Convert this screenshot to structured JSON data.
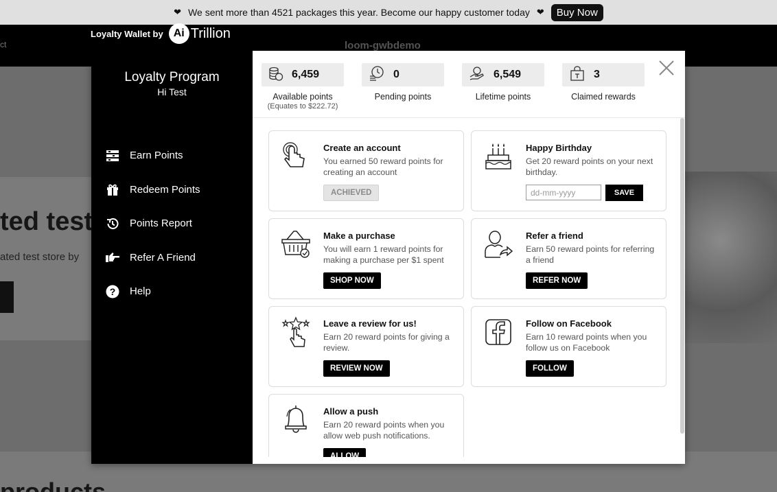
{
  "announcement": {
    "heart_left": "❤",
    "text": "We sent more than 4521 packages this year. Become our happy customer today",
    "heart_right": "❤",
    "buy_label": "Buy Now"
  },
  "store": {
    "nav_fragment": "ct",
    "name": "loom-gwbdemo",
    "hero_title": "ted test",
    "hero_sub": "ated test store by",
    "products_title": "products"
  },
  "wallet": {
    "by_label": "Loyalty Wallet by",
    "brand_mark": "Ai",
    "brand_name": "Trillion"
  },
  "sidebar": {
    "title": "Loyalty Program",
    "greeting": "Hi Test",
    "items": [
      {
        "label": "Earn Points",
        "icon": "earn-points-icon"
      },
      {
        "label": "Redeem Points",
        "icon": "gift-icon"
      },
      {
        "label": "Points Report",
        "icon": "history-icon"
      },
      {
        "label": "Refer A Friend",
        "icon": "pointing-hand-icon"
      },
      {
        "label": "Help",
        "icon": "help-icon"
      }
    ]
  },
  "stats": [
    {
      "value": "6,459",
      "label": "Available points",
      "note": "(Equates to $222.72)",
      "icon": "coins-icon"
    },
    {
      "value": "0",
      "label": "Pending points",
      "icon": "clock-coins-icon"
    },
    {
      "value": "6,549",
      "label": "Lifetime points",
      "icon": "hand-coin-icon"
    },
    {
      "value": "3",
      "label": "Claimed rewards",
      "icon": "gift-bag-icon"
    }
  ],
  "cards": [
    {
      "title": "Create an account",
      "desc": "You earned 50 reward points for creating an account",
      "button": "ACHIEVED",
      "icon": "tap-hand-icon"
    },
    {
      "title": "Happy Birthday",
      "desc": "Get 20 reward points on your next birthday.",
      "placeholder": "dd-mm-yyyy",
      "button": "SAVE",
      "icon": "birthday-cake-icon"
    },
    {
      "title": "Make a purchase",
      "desc": "You will earn 1 reward points for making a purchase per $1 spent",
      "button": "SHOP NOW",
      "icon": "shopping-basket-icon"
    },
    {
      "title": "Refer a friend",
      "desc": "Earn 50 reward points for referring a friend",
      "button": "REFER NOW",
      "icon": "refer-person-icon"
    },
    {
      "title": "Leave a review for us!",
      "desc": "Earn 20 reward points for giving a review.",
      "button": "REVIEW NOW",
      "icon": "review-stars-icon"
    },
    {
      "title": "Follow on Facebook",
      "desc": "Earn 10 reward points when you follow us on Facebook",
      "button": "FOLLOW",
      "icon": "facebook-icon"
    },
    {
      "title": "Allow a push",
      "desc": "Earn 20 reward points when you allow web push notifications.",
      "button": "ALLOW",
      "icon": "bell-icon"
    }
  ]
}
